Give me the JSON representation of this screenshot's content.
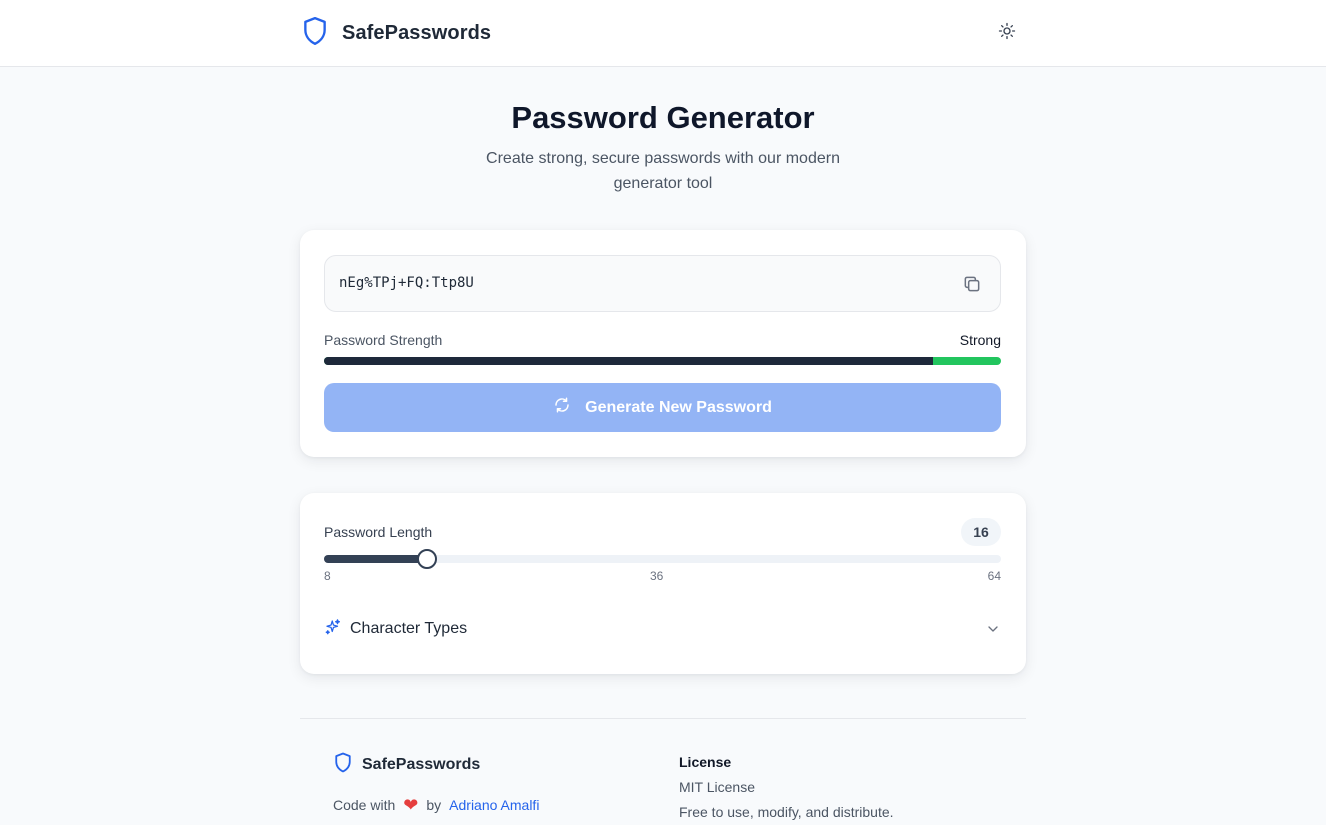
{
  "header": {
    "brand": "SafePasswords",
    "theme_toggle_icon": "sun-icon"
  },
  "hero": {
    "title": "Password Generator",
    "subtitle": "Create strong, secure passwords with our modern generator tool"
  },
  "generator": {
    "password": "nEg%TPj+FQ:Ttp8U",
    "copy_icon": "copy-icon",
    "strength_label": "Password Strength",
    "strength_value": "Strong",
    "strength_fraction": 0.9,
    "button_label": "Generate New Password",
    "button_icon": "refresh-icon"
  },
  "options": {
    "length_label": "Password Length",
    "length_value": "16",
    "length": 16,
    "min_label": "8",
    "mid_label": "36",
    "max_label": "64",
    "min": 8,
    "max": 64,
    "char_types_label": "Character Types",
    "char_types_icon": "sparkles-icon"
  },
  "footer": {
    "brand": "SafePasswords",
    "credit_prefix": "Code with",
    "credit_by": "by",
    "author": "Adriano Amalfi",
    "license_title": "License",
    "license_name": "MIT License",
    "license_desc": "Free to use, modify, and distribute."
  },
  "colors": {
    "accent": "#2563eb",
    "button_bg": "#93b4f5",
    "strength_good": "#22c55e",
    "slider_fill": "#334155",
    "heart": "#e53e3e"
  }
}
